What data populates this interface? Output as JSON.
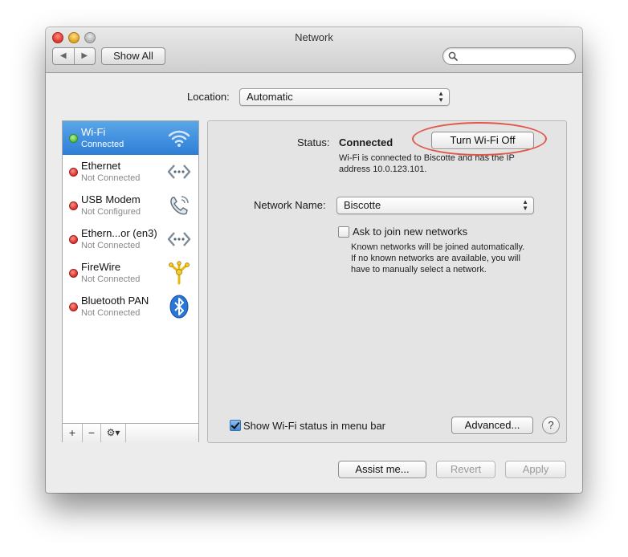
{
  "window": {
    "title": "Network",
    "show_all_label": "Show All",
    "nav_back": "◀",
    "nav_forward": "▶",
    "search_placeholder": ""
  },
  "location": {
    "label": "Location:",
    "value": "Automatic"
  },
  "services": [
    {
      "name": "Wi-Fi",
      "state": "Connected",
      "status_color": "#58c13a",
      "icon": "wifi-icon",
      "selected": true
    },
    {
      "name": "Ethernet",
      "state": "Not Connected",
      "status_color": "#d6302a",
      "icon": "ethernet-icon",
      "selected": false
    },
    {
      "name": "USB Modem",
      "state": "Not Configured",
      "status_color": "#d6302a",
      "icon": "phone-icon",
      "selected": false
    },
    {
      "name": "Ethern...or (en3)",
      "state": "Not Connected",
      "status_color": "#d6302a",
      "icon": "ethernet-icon",
      "selected": false
    },
    {
      "name": "FireWire",
      "state": "Not Connected",
      "status_color": "#d6302a",
      "icon": "firewire-icon",
      "selected": false
    },
    {
      "name": "Bluetooth PAN",
      "state": "Not Connected",
      "status_color": "#d6302a",
      "icon": "bluetooth-icon",
      "selected": false
    }
  ],
  "sidebar_buttons": {
    "add": "+",
    "remove": "−",
    "action": "⚙▾"
  },
  "detail": {
    "status_label": "Status:",
    "status_value": "Connected",
    "turn_off_label": "Turn Wi-Fi Off",
    "status_desc_line1": "Wi-Fi is connected to Biscotte and has the IP",
    "status_desc_line2": "address 10.0.123.101.",
    "network_name_label": "Network Name:",
    "network_name_value": "Biscotte",
    "ask_join_label": "Ask to join new networks",
    "ask_join_checked": false,
    "ask_desc_line1": "Known networks will be joined automatically.",
    "ask_desc_line2": "If no known networks are available, you will",
    "ask_desc_line3": "have to manually select a network.",
    "show_status_label": "Show Wi-Fi status in menu bar",
    "show_status_checked": true,
    "advanced_label": "Advanced...",
    "help_label": "?"
  },
  "footer": {
    "assist_label": "Assist me...",
    "revert_label": "Revert",
    "apply_label": "Apply"
  },
  "colors": {
    "selection": "#2e7ed6",
    "highlight_ring": "#e0584a"
  }
}
